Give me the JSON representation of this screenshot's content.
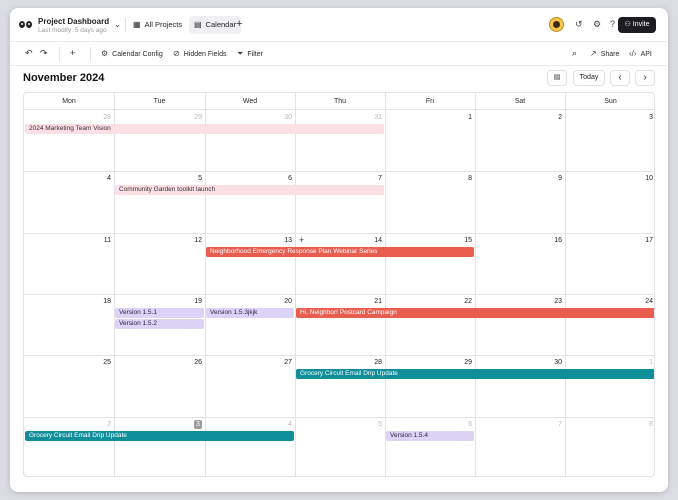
{
  "topbar": {
    "project_title": "Project Dashboard",
    "last_modify": "Last modify: 5 days ago",
    "tab_all_projects": "All Projects",
    "tab_calendar": "Calendar",
    "add_view": "+",
    "invite_label": "Invite"
  },
  "toolbar": {
    "undo": "↶",
    "redo": "↷",
    "add": "+",
    "calendar_config": "Calendar Config",
    "hidden_fields": "Hidden Fields",
    "filter": "Filter",
    "share": "Share",
    "api": "API"
  },
  "calendar": {
    "month_title": "November 2024",
    "today_label": "Today",
    "prev": "‹",
    "next": "›",
    "days_of_week": [
      "Mon",
      "Tue",
      "Wed",
      "Thu",
      "Fri",
      "Sat",
      "Sun"
    ],
    "weeks": [
      [
        {
          "d": "28",
          "o": true
        },
        {
          "d": "29",
          "o": true
        },
        {
          "d": "30",
          "o": true
        },
        {
          "d": "31",
          "o": true
        },
        {
          "d": "1"
        },
        {
          "d": "2"
        },
        {
          "d": "3"
        }
      ],
      [
        {
          "d": "4"
        },
        {
          "d": "5"
        },
        {
          "d": "6"
        },
        {
          "d": "7"
        },
        {
          "d": "8"
        },
        {
          "d": "9"
        },
        {
          "d": "10"
        }
      ],
      [
        {
          "d": "11"
        },
        {
          "d": "12"
        },
        {
          "d": "13"
        },
        {
          "d": "14"
        },
        {
          "d": "15"
        },
        {
          "d": "16"
        },
        {
          "d": "17"
        }
      ],
      [
        {
          "d": "18"
        },
        {
          "d": "19"
        },
        {
          "d": "20"
        },
        {
          "d": "21"
        },
        {
          "d": "22"
        },
        {
          "d": "23"
        },
        {
          "d": "24"
        }
      ],
      [
        {
          "d": "25"
        },
        {
          "d": "26"
        },
        {
          "d": "27"
        },
        {
          "d": "28"
        },
        {
          "d": "29"
        },
        {
          "d": "30"
        },
        {
          "d": "1",
          "o": true
        }
      ],
      [
        {
          "d": "2",
          "o": true
        },
        {
          "d": "3",
          "o": true,
          "today": true
        },
        {
          "d": "4",
          "o": true
        },
        {
          "d": "5",
          "o": true
        },
        {
          "d": "6",
          "o": true
        },
        {
          "d": "7",
          "o": true
        },
        {
          "d": "8",
          "o": true
        }
      ]
    ],
    "events": [
      {
        "title": "2024 Marketing Team Vision",
        "week": 0,
        "start": 0,
        "span": 4,
        "lane": 0,
        "color": "pink"
      },
      {
        "title": "Community Garden toolkit launch",
        "week": 1,
        "start": 1,
        "span": 3,
        "lane": 0,
        "color": "pink"
      },
      {
        "title": "Neighborhood Emergency Response Plan Webinar Series",
        "week": 2,
        "start": 2,
        "span": 3,
        "lane": 0,
        "color": "red"
      },
      {
        "title": "Version 1.5.1",
        "week": 3,
        "start": 1,
        "span": 1,
        "lane": 0,
        "color": "lav"
      },
      {
        "title": "Version 1.5.2",
        "week": 3,
        "start": 1,
        "span": 1,
        "lane": 1,
        "color": "lav"
      },
      {
        "title": "Version 1.5.3jkjk",
        "week": 3,
        "start": 2,
        "span": 1,
        "lane": 0,
        "color": "lav"
      },
      {
        "title": "Hi, Neighbor! Postcard Campaign",
        "week": 3,
        "start": 3,
        "span": 4,
        "lane": 0,
        "color": "red"
      },
      {
        "title": "Grocery Circuit Email Drip Update",
        "week": 4,
        "start": 3,
        "span": 4,
        "lane": 0,
        "color": "teal"
      },
      {
        "title": "Grocery Circuit Email Drip Update",
        "week": 5,
        "start": 0,
        "span": 3,
        "lane": 0,
        "color": "teal"
      },
      {
        "title": "Version 1.5.4",
        "week": 5,
        "start": 4,
        "span": 1,
        "lane": 0,
        "color": "lav"
      }
    ],
    "hover_add_cell": "+",
    "colors": {
      "pink": "#fbe0e6",
      "red": "#e95d4f",
      "teal": "#108f9b",
      "lavender": "#ddd3f7"
    }
  }
}
